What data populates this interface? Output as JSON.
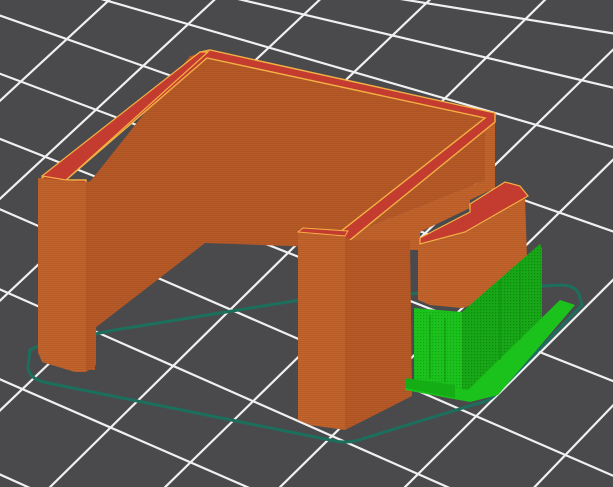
{
  "viewport": {
    "background": "#4a4a4d",
    "grid_color": "#f4f4f4",
    "skirt_color": "#1a6d5a",
    "wall_color": "#b85a28",
    "wall_shade_color": "#a64f22",
    "wall_side_color": "#c0652d",
    "top_surface_color": "#c43b2f",
    "perimeter_color": "#f2b144",
    "support_color": "#1cc21c",
    "support_shade_color": "#169a16"
  }
}
